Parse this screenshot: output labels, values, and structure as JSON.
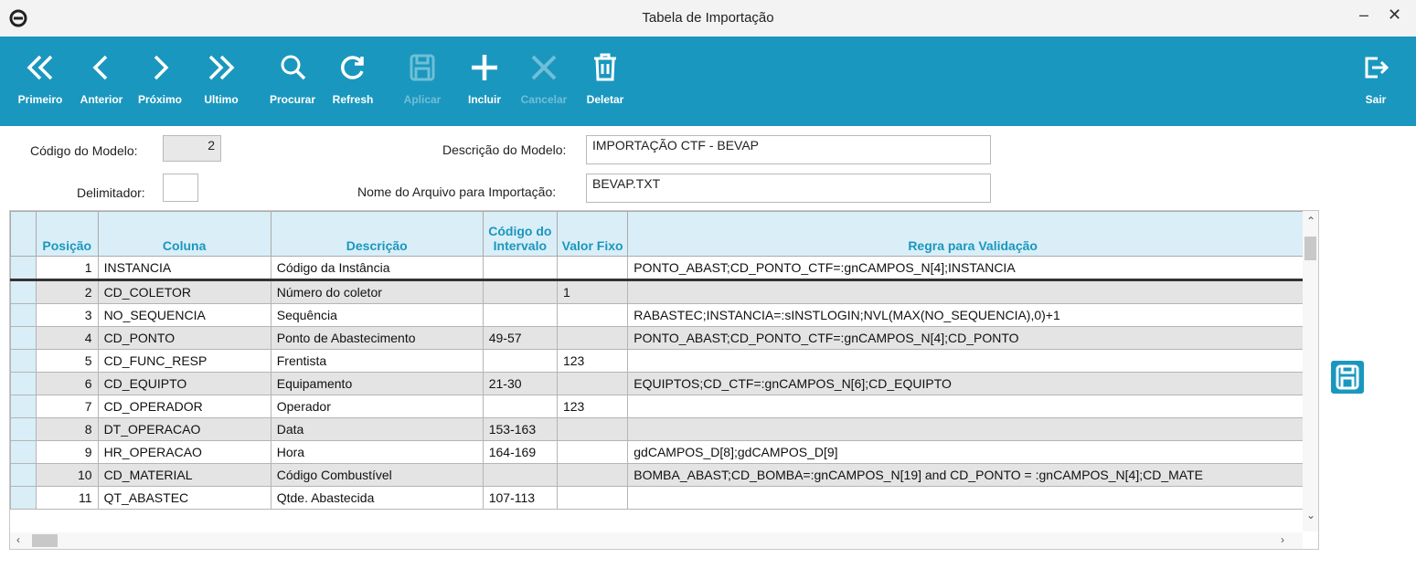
{
  "window": {
    "title": "Tabela de Importação",
    "minimize": "–",
    "close": "✕"
  },
  "toolbar": {
    "first": "Primeiro",
    "prev": "Anterior",
    "next": "Próximo",
    "last": "Ultimo",
    "search": "Procurar",
    "refresh": "Refresh",
    "apply": "Aplicar",
    "add": "Incluir",
    "cancel": "Cancelar",
    "delete": "Deletar",
    "exit": "Sair"
  },
  "form": {
    "model_code_label": "Código do Modelo:",
    "model_code": "2",
    "delimiter_label": "Delimitador:",
    "delimiter": "",
    "model_desc_label": "Descrição do Modelo:",
    "model_desc": "IMPORTAÇÃO CTF - BEVAP",
    "file_name_label": "Nome do Arquivo para Importação:",
    "file_name": "BEVAP.TXT"
  },
  "grid": {
    "headers": {
      "posicao": "Posição",
      "coluna": "Coluna",
      "descricao": "Descrição",
      "codigo_intervalo": "Código do Intervalo",
      "valor_fixo": "Valor Fixo",
      "regra": "Regra para Validação"
    },
    "rows": [
      {
        "posicao": "1",
        "coluna": "INSTANCIA",
        "descricao": "Código da Instância",
        "intervalo": "",
        "valor_fixo": "",
        "regra": "PONTO_ABAST;CD_PONTO_CTF=:gnCAMPOS_N[4];INSTANCIA"
      },
      {
        "posicao": "2",
        "coluna": "CD_COLETOR",
        "descricao": "Número do coletor",
        "intervalo": "",
        "valor_fixo": "1",
        "regra": ""
      },
      {
        "posicao": "3",
        "coluna": "NO_SEQUENCIA",
        "descricao": "Sequência",
        "intervalo": "",
        "valor_fixo": "",
        "regra": "RABASTEC;INSTANCIA=:sINSTLOGIN;NVL(MAX(NO_SEQUENCIA),0)+1"
      },
      {
        "posicao": "4",
        "coluna": "CD_PONTO",
        "descricao": "Ponto de Abastecimento",
        "intervalo": "49-57",
        "valor_fixo": "",
        "regra": "PONTO_ABAST;CD_PONTO_CTF=:gnCAMPOS_N[4];CD_PONTO"
      },
      {
        "posicao": "5",
        "coluna": "CD_FUNC_RESP",
        "descricao": "Frentista",
        "intervalo": "",
        "valor_fixo": "123",
        "regra": ""
      },
      {
        "posicao": "6",
        "coluna": "CD_EQUIPTO",
        "descricao": "Equipamento",
        "intervalo": "21-30",
        "valor_fixo": "",
        "regra": "EQUIPTOS;CD_CTF=:gnCAMPOS_N[6];CD_EQUIPTO"
      },
      {
        "posicao": "7",
        "coluna": "CD_OPERADOR",
        "descricao": "Operador",
        "intervalo": "",
        "valor_fixo": "123",
        "regra": ""
      },
      {
        "posicao": "8",
        "coluna": "DT_OPERACAO",
        "descricao": "Data",
        "intervalo": "153-163",
        "valor_fixo": "",
        "regra": ""
      },
      {
        "posicao": "9",
        "coluna": "HR_OPERACAO",
        "descricao": "Hora",
        "intervalo": "164-169",
        "valor_fixo": "",
        "regra": "gdCAMPOS_D[8];gdCAMPOS_D[9]"
      },
      {
        "posicao": "10",
        "coluna": "CD_MATERIAL",
        "descricao": "Código Combustível",
        "intervalo": "",
        "valor_fixo": "",
        "regra": "BOMBA_ABAST;CD_BOMBA=:gnCAMPOS_N[19] and CD_PONTO = :gnCAMPOS_N[4];CD_MATE"
      },
      {
        "posicao": "11",
        "coluna": "QT_ABASTEC",
        "descricao": "Qtde. Abastecida",
        "intervalo": "107-113",
        "valor_fixo": "",
        "regra": ""
      }
    ]
  },
  "colors": {
    "toolbar": "#1a97be",
    "header_text": "#1a97be"
  }
}
